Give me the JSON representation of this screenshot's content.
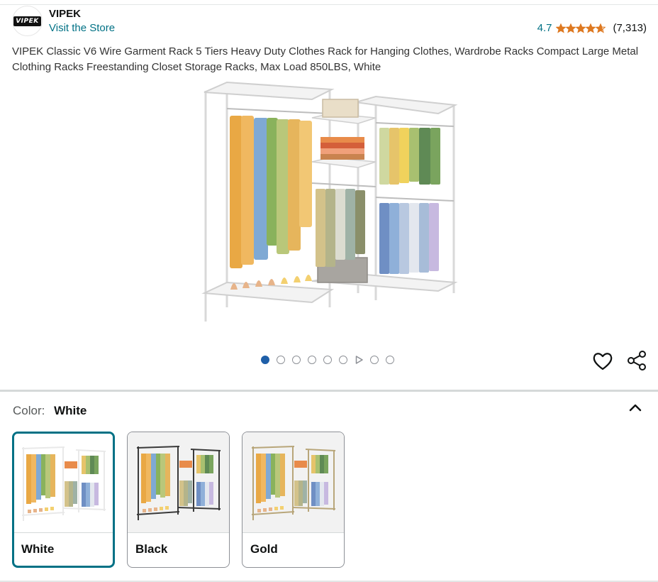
{
  "brand": {
    "logo_text": "VIPEK",
    "name": "VIPEK",
    "store_link": "Visit the Store"
  },
  "rating": {
    "score": "4.7",
    "stars_value": 4.7,
    "count": "(7,313)"
  },
  "product": {
    "title": "VIPEK Classic V6 Wire Garment Rack 5 Tiers Heavy Duty Clothes Rack for Hanging Clothes, Wardrobe Racks Compact Large Metal Clothing Racks Freestanding Closet Storage Racks, Max Load 850LBS, White"
  },
  "gallery": {
    "total_items": 9,
    "active_index": 0,
    "video_index": 6
  },
  "icons": {
    "wishlist": "heart-icon",
    "share": "share-icon",
    "collapse": "chevron-up-icon"
  },
  "variation": {
    "label": "Color:",
    "selected": "White",
    "options": [
      {
        "name": "White",
        "frame_color": "#e9e9e9"
      },
      {
        "name": "Black",
        "frame_color": "#3a3a3a"
      },
      {
        "name": "Gold",
        "frame_color": "#b8a67a"
      }
    ]
  },
  "colors": {
    "link": "#007185",
    "star": "#de7921",
    "active_dot": "#1f5fa8",
    "selected_border": "#007185"
  }
}
